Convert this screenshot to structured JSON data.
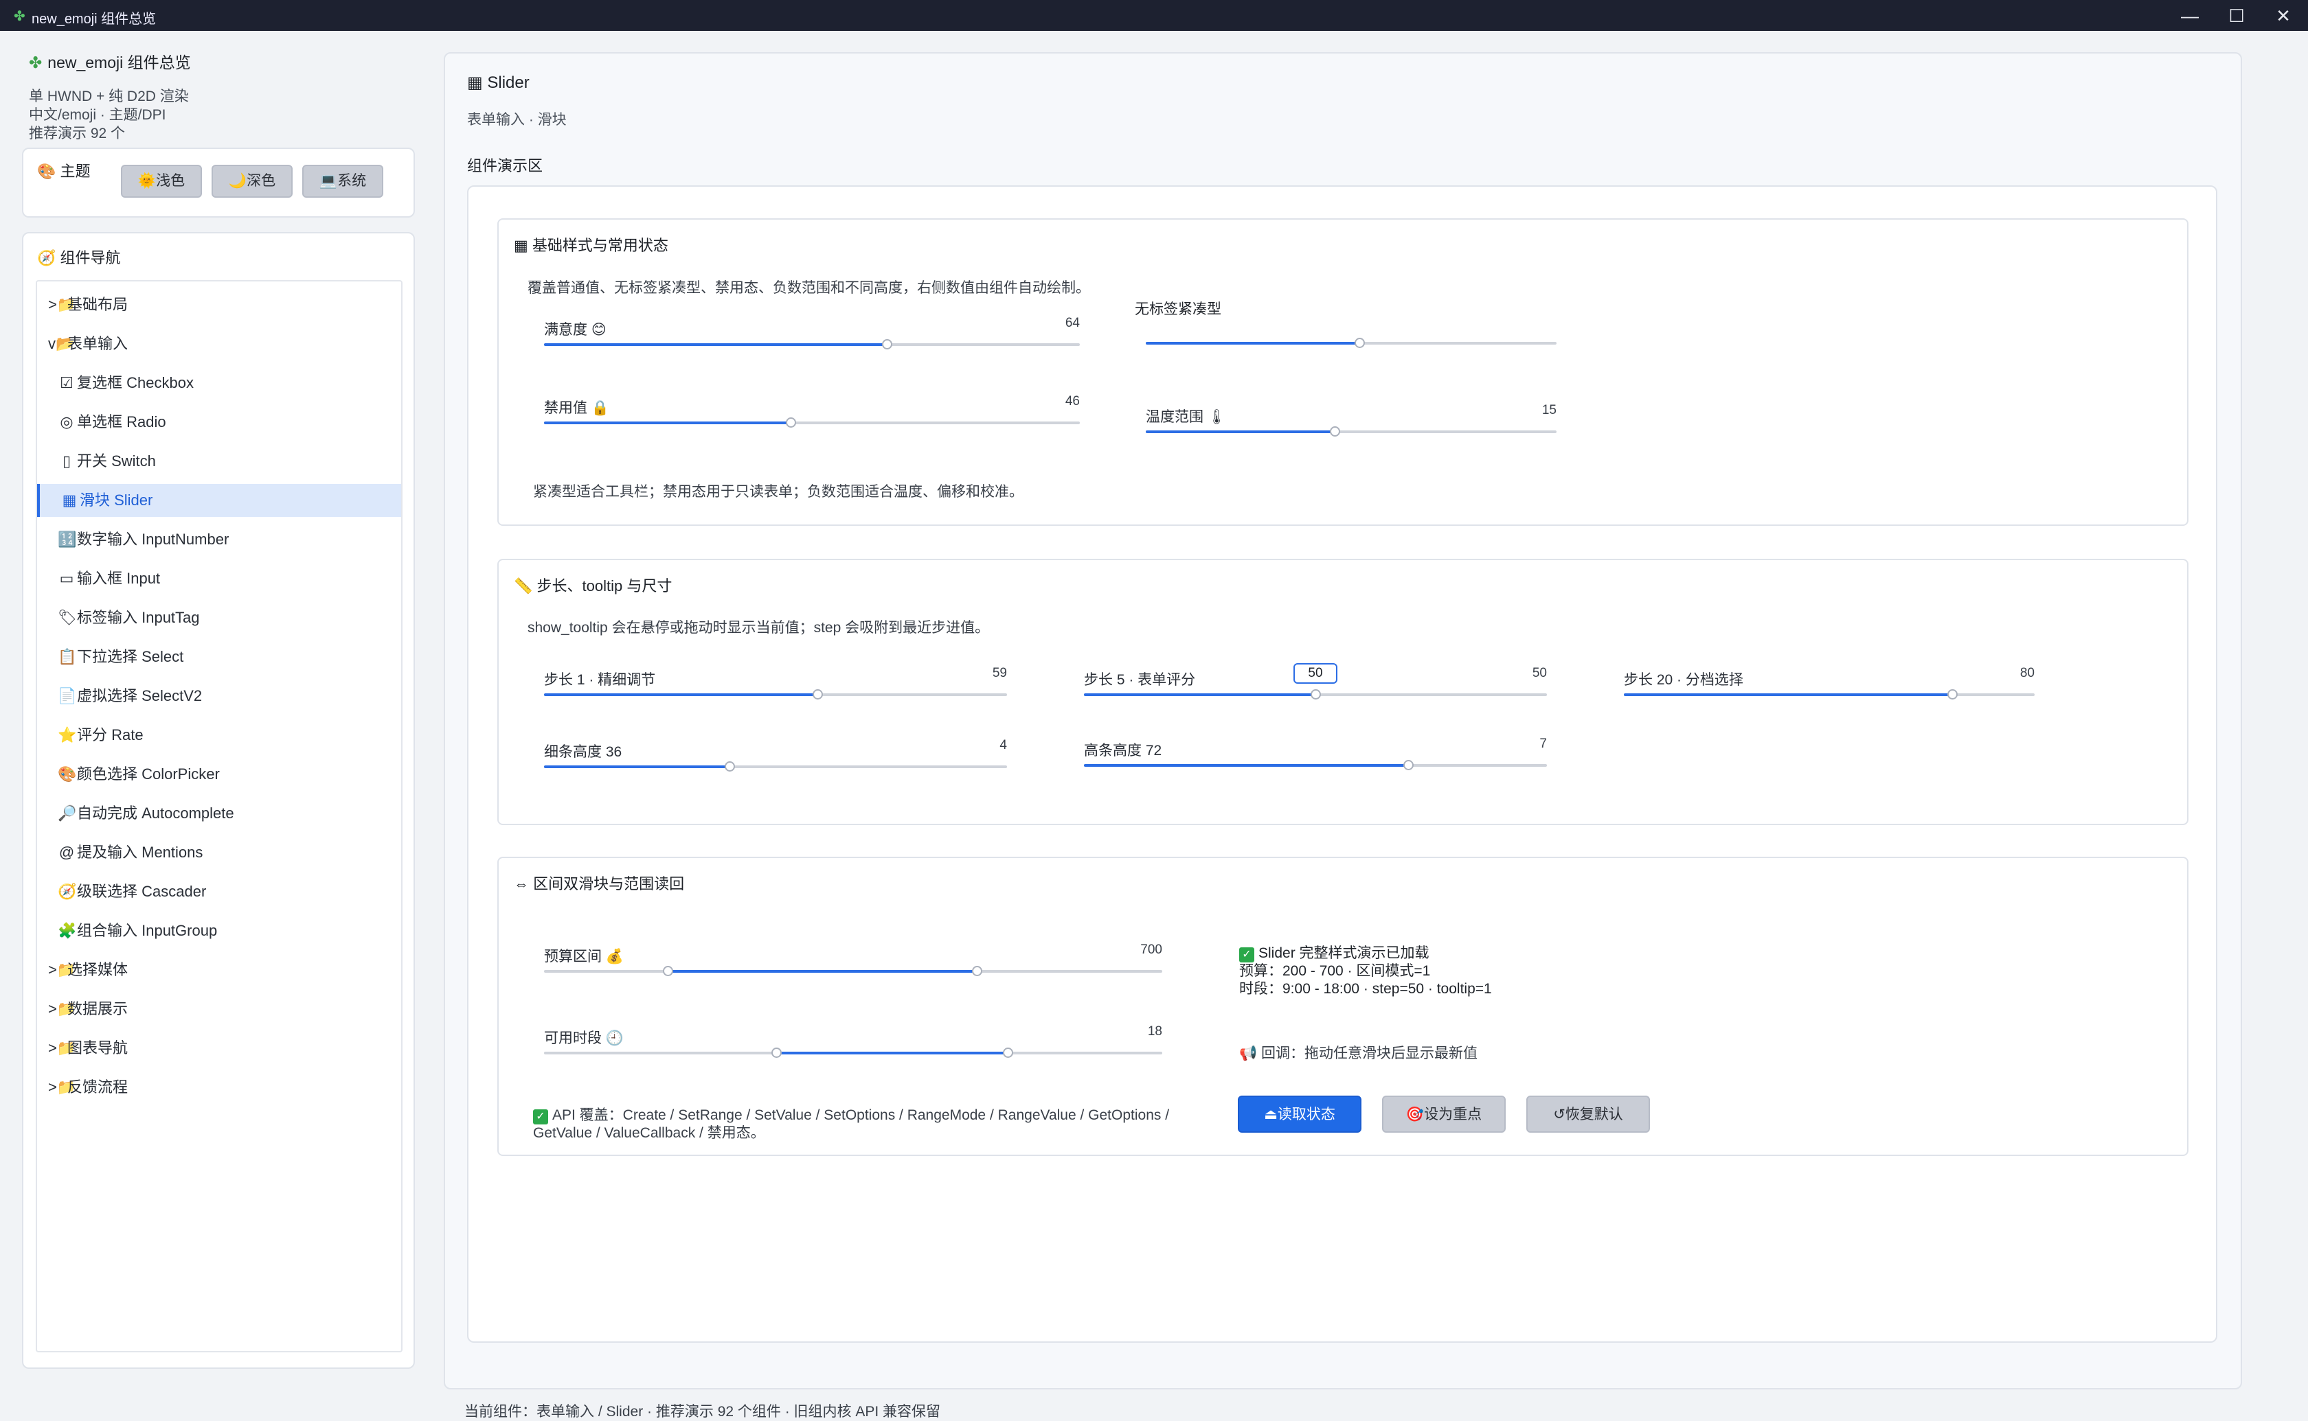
{
  "window": {
    "title": "new_emoji 组件总览",
    "app_icon": "clover-icon",
    "buttons": {
      "minimize": "—",
      "maximize": "☐",
      "close": "✕"
    }
  },
  "sidebar": {
    "app_name": "new_emoji 组件总览",
    "info_lines": [
      "单 HWND + 纯 D2D 渲染",
      "中文/emoji · 主题/DPI",
      "推荐演示 92 个"
    ],
    "theme": {
      "title": "主题",
      "buttons": [
        {
          "icon": "🌞",
          "label": "浅色"
        },
        {
          "icon": "🌙",
          "label": "深色"
        },
        {
          "icon": "💻",
          "label": "系统"
        }
      ]
    },
    "nav": {
      "title": "组件导航",
      "items": [
        {
          "prefix": ">📁",
          "label": "基础布局",
          "level": 0
        },
        {
          "prefix": "v📂",
          "label": "表单输入",
          "level": 0
        },
        {
          "prefix": "☑",
          "label": "复选框 Checkbox",
          "level": 1
        },
        {
          "prefix": "◎",
          "label": "单选框 Radio",
          "level": 1
        },
        {
          "prefix": "▯",
          "label": "开关 Switch",
          "level": 1
        },
        {
          "prefix": "▦",
          "label": "滑块 Slider",
          "level": 1,
          "selected": true
        },
        {
          "prefix": "🔢",
          "label": "数字输入 InputNumber",
          "level": 1
        },
        {
          "prefix": "▭",
          "label": "输入框 Input",
          "level": 1
        },
        {
          "prefix": "🏷",
          "label": "标签输入 InputTag",
          "level": 1
        },
        {
          "prefix": "📋",
          "label": "下拉选择 Select",
          "level": 1
        },
        {
          "prefix": "📄",
          "label": "虚拟选择 SelectV2",
          "level": 1
        },
        {
          "prefix": "⭐",
          "label": "评分 Rate",
          "level": 1
        },
        {
          "prefix": "🎨",
          "label": "颜色选择 ColorPicker",
          "level": 1
        },
        {
          "prefix": "🔎",
          "label": "自动完成 Autocomplete",
          "level": 1
        },
        {
          "prefix": "@",
          "label": "提及输入 Mentions",
          "level": 1
        },
        {
          "prefix": "🧭",
          "label": "级联选择 Cascader",
          "level": 1
        },
        {
          "prefix": "🧩",
          "label": "组合输入 InputGroup",
          "level": 1
        },
        {
          "prefix": ">📁",
          "label": "选择媒体",
          "level": 0
        },
        {
          "prefix": ">📁",
          "label": "数据展示",
          "level": 0
        },
        {
          "prefix": ">📁",
          "label": "图表导航",
          "level": 0
        },
        {
          "prefix": ">📁",
          "label": "反馈流程",
          "level": 0
        }
      ]
    }
  },
  "main": {
    "title": "Slider",
    "subtitle": "表单输入 · 滑块",
    "demo_label": "组件演示区",
    "section1": {
      "title": "基础样式与常用状态",
      "desc": "覆盖普通值、无标签紧凑型、禁用态、负数范围和不同高度，右侧数值由组件自动绘制。",
      "compact_label": "无标签紧凑型",
      "note": "紧凑型适合工具栏；禁用态用于只读表单；负数范围适合温度、偏移和校准。",
      "sliders": [
        {
          "label": "满意度 😊",
          "value": "64",
          "fraction": 0.64
        },
        {
          "label": "禁用值 🔒",
          "value": "46",
          "fraction": 0.46
        },
        {
          "label": "",
          "value": "",
          "fraction": 0.52
        },
        {
          "label": "温度范围 🌡",
          "value": "15",
          "fraction": 0.46
        }
      ]
    },
    "section2": {
      "title": "步长、tooltip 与尺寸",
      "desc": "show_tooltip 会在悬停或拖动时显示当前值；step 会吸附到最近步进值。",
      "sliders": [
        {
          "label": "步长 1 · 精细调节",
          "value": "59",
          "fraction": 0.59
        },
        {
          "label": "步长 5 · 表单评分",
          "value": "50",
          "fraction": 0.5,
          "tooltip": "50"
        },
        {
          "label": "步长 20 · 分档选择",
          "value": "80",
          "fraction": 0.8
        },
        {
          "label": "细条高度 36",
          "value": "4",
          "fraction": 0.4
        },
        {
          "label": "高条高度 72",
          "value": "7",
          "fraction": 0.7
        }
      ]
    },
    "section3": {
      "title": "区间双滑块与范围读回",
      "ranges": [
        {
          "label": "预算区间 💰",
          "value": "700",
          "low": 0.2,
          "high": 0.7
        },
        {
          "label": "可用时段 🕘",
          "value": "18",
          "low": 0.375,
          "high": 0.75
        }
      ],
      "status_title": "Slider 完整样式演示已加载",
      "status_line1": "预算：200 - 700 · 区间模式=1",
      "status_line2": "时段：9:00 - 18:00 · step=50 · tooltip=1",
      "callback": "回调：拖动任意滑块后显示最新值",
      "api_note": "API 覆盖：Create / SetRange / SetValue / SetOptions / RangeMode / RangeValue / GetOptions / GetValue / ValueCallback / 禁用态。",
      "buttons": {
        "read": "读取状态",
        "focus": "设为重点",
        "reset": "恢复默认"
      }
    }
  },
  "footer": "当前组件：表单输入 / Slider · 推荐演示 92 个组件 · 旧组内核 API 兼容保留",
  "colors": {
    "accent": "#2b6de5",
    "titlebar": "#1d2130",
    "selected_bg": "#dce8fb"
  }
}
